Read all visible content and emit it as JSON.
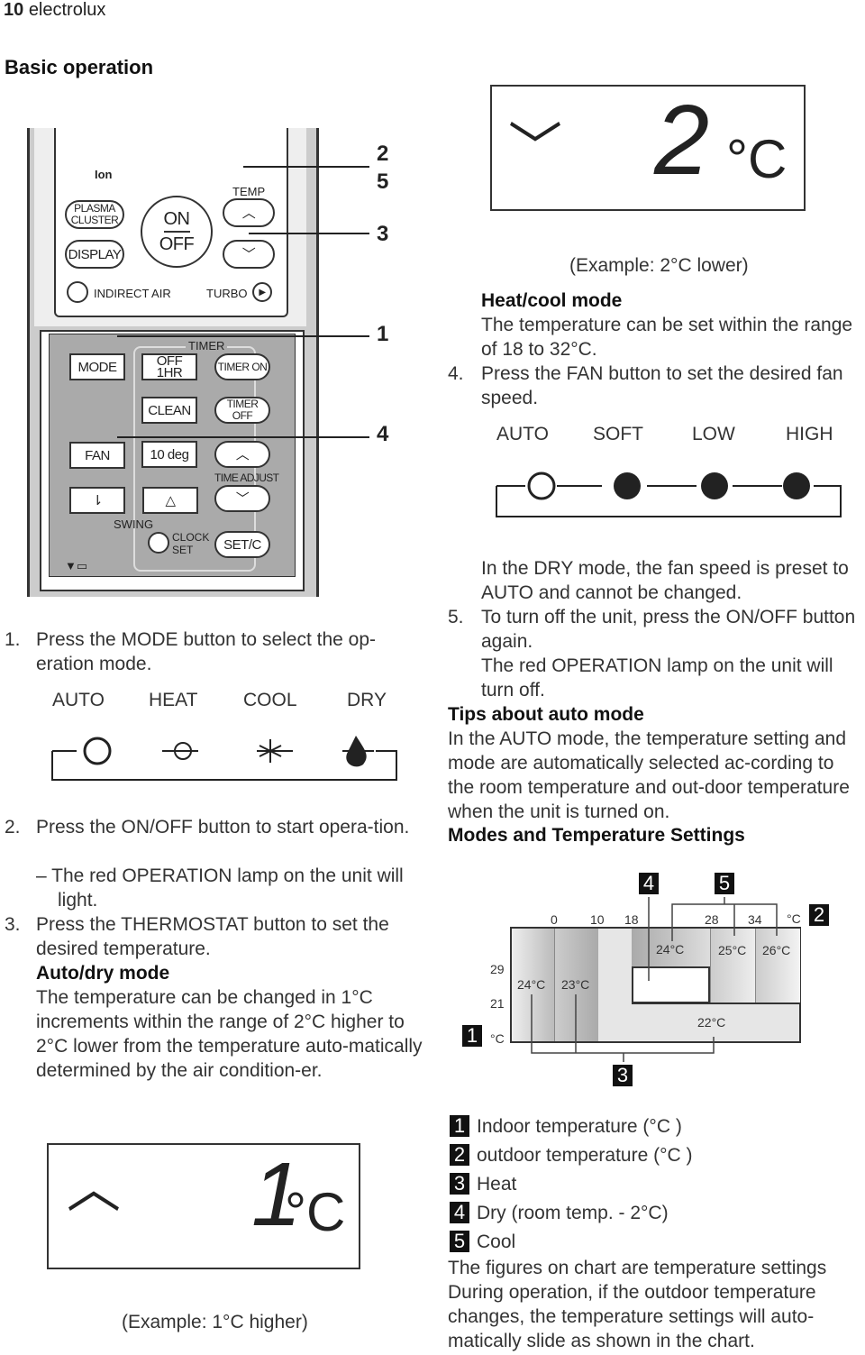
{
  "header": {
    "page_number": "10",
    "brand": "electrolux"
  },
  "section_title": "Basic operation",
  "remote": {
    "ion": "Ion",
    "plasma": "PLASMA CLUSTER",
    "display": "DISPLAY",
    "on": "ON",
    "off": "OFF",
    "temp": "TEMP",
    "indirect_air": "INDIRECT AIR",
    "turbo": "TURBO",
    "timer": "TIMER",
    "mode": "MODE",
    "off_1hr": "OFF 1HR",
    "timer_on": "TIMER ON",
    "clean": "CLEAN",
    "timer_off": "TIMER OFF",
    "fan": "FAN",
    "ten_deg": "10 deg",
    "time_adjust": "TIME ADJUST",
    "swing": "SWING",
    "clock_set": "CLOCK SET",
    "set_c": "SET/C",
    "callouts": [
      "2",
      "5",
      "3",
      "1",
      "4"
    ]
  },
  "steps_left": {
    "step1": "1.",
    "step1_text": "Press the MODE button to select the op-eration mode.",
    "modes": [
      "AUTO",
      "HEAT",
      "COOL",
      "DRY"
    ],
    "step2": "2.",
    "step2_text": "Press the ON/OFF button to start opera-tion.",
    "step2_sub": "– The red OPERATION lamp on the unit will light.",
    "step3": "3.",
    "step3_text": "Press the THERMOSTAT button to set the desired temperature.",
    "auto_dry_title": "Auto/dry mode",
    "auto_dry_text": "The temperature can be changed in 1°C increments within the range of 2°C higher to 2°C lower from the temperature auto-matically determined by the air condition-er.",
    "display_digit": "1",
    "display_unit": "°C",
    "example": "(Example: 1°C higher)"
  },
  "right": {
    "display_digit": "2",
    "display_unit": "°C",
    "example": "(Example: 2°C lower)",
    "heat_cool_title": "Heat/cool mode",
    "heat_cool_text": "The temperature can be set within the range of 18 to 32°C.",
    "step4": "4.",
    "step4_text": "Press the FAN button to set the desired fan speed.",
    "fan_speeds": [
      "AUTO",
      "SOFT",
      "LOW",
      "HIGH"
    ],
    "dry_note": "In the DRY mode, the fan speed is preset to AUTO and cannot be changed.",
    "step5": "5.",
    "step5_text": "To turn off the unit, press the ON/OFF button again.",
    "step5_sub": "The red OPERATION lamp on the unit will turn off.",
    "tips_title": "Tips about auto mode",
    "tips_text": "In the AUTO mode, the temperature setting and mode are automatically selected ac-cording to the room temperature and out-door temperature when the unit is turned on.",
    "modes_title": "Modes and Temperature Settings"
  },
  "diagram": {
    "outdoor_ticks": [
      "0",
      "10",
      "18",
      "28",
      "34"
    ],
    "outdoor_unit": "°C",
    "indoor_ticks": [
      "29",
      "21"
    ],
    "indoor_unit": "°C",
    "cells": [
      "24°C",
      "23°C",
      "24°C",
      "25°C",
      "26°C",
      "22°C"
    ],
    "markers": [
      "1",
      "2",
      "3",
      "4",
      "5"
    ]
  },
  "legend": [
    {
      "num": "1",
      "text": "Indoor temperature (°C )"
    },
    {
      "num": "2",
      "text": "outdoor temperature (°C )"
    },
    {
      "num": "3",
      "text": "Heat"
    },
    {
      "num": "4",
      "text": "Dry (room temp. - 2°C)"
    },
    {
      "num": "5",
      "text": "Cool"
    }
  ],
  "footer_text": "The figures on chart are temperature settings During operation, if the outdoor temperature changes, the temperature settings will auto-matically slide as shown in the chart."
}
